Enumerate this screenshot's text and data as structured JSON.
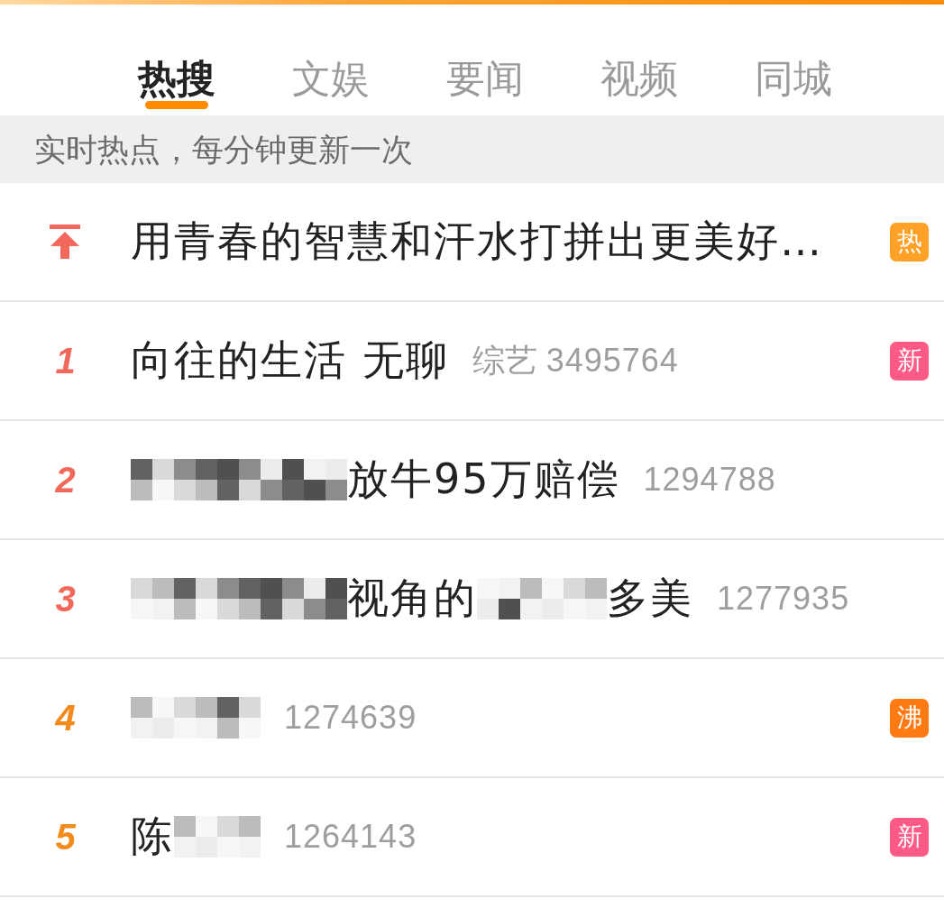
{
  "tabs": [
    {
      "label": "热搜",
      "selected": true
    },
    {
      "label": "文娱",
      "selected": false
    },
    {
      "label": "要闻",
      "selected": false
    },
    {
      "label": "视频",
      "selected": false
    },
    {
      "label": "同城",
      "selected": false
    }
  ],
  "notice": "实时热点，每分钟更新一次",
  "items": [
    {
      "kind": "pinned",
      "title": [
        {
          "kind": "text",
          "text": "用青春的智慧和汗水打拼出更美好…"
        }
      ],
      "badge": {
        "text": "热",
        "color": "#ffa126"
      }
    },
    {
      "kind": "ranked",
      "rank": "1",
      "color": "#f2685a",
      "title": [
        {
          "kind": "text",
          "text": "向往的生活 无聊"
        }
      ],
      "category": "综艺",
      "count": "3495764",
      "badge": {
        "text": "新",
        "color": "#fd5b86"
      }
    },
    {
      "kind": "ranked",
      "rank": "2",
      "color": "#f2685a",
      "title": [
        {
          "kind": "mosaic"
        },
        {
          "kind": "mosaic"
        },
        {
          "kind": "mosaic"
        },
        {
          "kind": "mosaic"
        },
        {
          "kind": "mosaic"
        },
        {
          "kind": "text",
          "text": "放牛95万赔偿"
        }
      ],
      "count": "1294788"
    },
    {
      "kind": "ranked",
      "rank": "3",
      "color": "#f2685a",
      "title": [
        {
          "kind": "mosaic"
        },
        {
          "kind": "mosaic"
        },
        {
          "kind": "mosaic"
        },
        {
          "kind": "mosaic"
        },
        {
          "kind": "mosaic"
        },
        {
          "kind": "text",
          "text": "视角的"
        },
        {
          "kind": "mosaic"
        },
        {
          "kind": "mosaic"
        },
        {
          "kind": "mosaic"
        },
        {
          "kind": "text",
          "text": "多美"
        }
      ],
      "count": "1277935"
    },
    {
      "kind": "ranked",
      "rank": "4",
      "color": "#f28a1c",
      "title": [
        {
          "kind": "mosaic"
        },
        {
          "kind": "mosaic"
        },
        {
          "kind": "mosaic"
        }
      ],
      "count": "1274639",
      "badge": {
        "text": "沸",
        "color": "#ff7a12"
      }
    },
    {
      "kind": "ranked",
      "rank": "5",
      "color": "#f28a1c",
      "title": [
        {
          "kind": "text",
          "text": "陈"
        },
        {
          "kind": "mosaic"
        },
        {
          "kind": "mosaic"
        }
      ],
      "count": "1264143",
      "badge": {
        "text": "新",
        "color": "#fd5b86"
      }
    }
  ]
}
